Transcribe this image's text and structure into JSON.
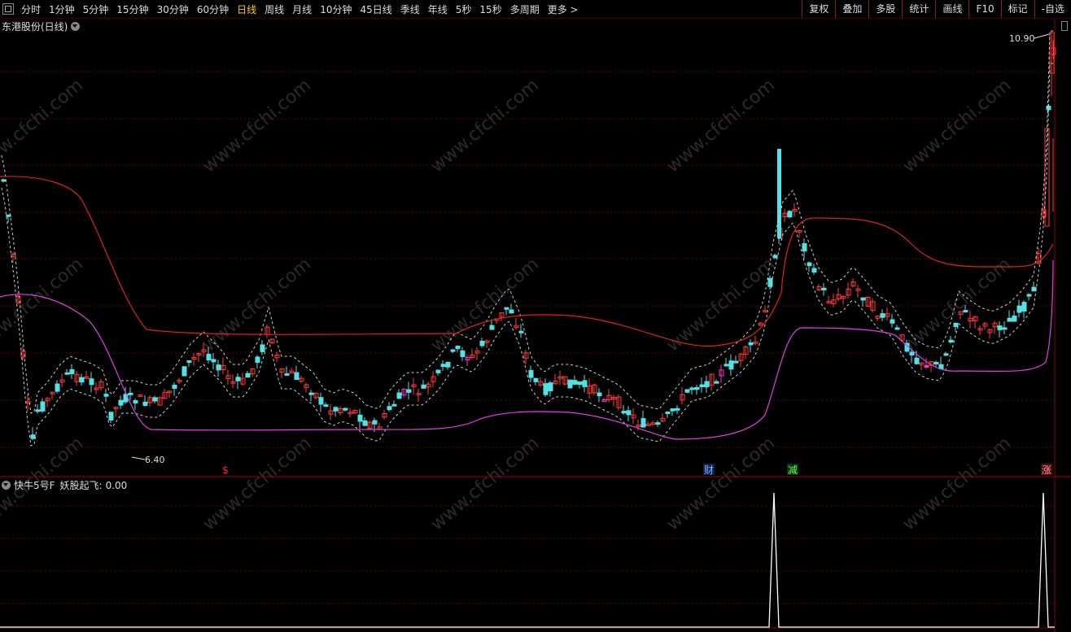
{
  "toolbar": {
    "periods": [
      "分时",
      "1分钟",
      "5分钟",
      "15分钟",
      "30分钟",
      "60分钟",
      "日线",
      "周线",
      "月线",
      "10分钟",
      "45日线",
      "季线",
      "年线",
      "5秒",
      "15秒",
      "多周期",
      "更多 >"
    ],
    "active_period": "日线",
    "right_buttons": [
      "复权",
      "叠加",
      "多股",
      "统计",
      "画线",
      "F10",
      "标记",
      "-自选"
    ]
  },
  "main_chart": {
    "title": "东港股份(日线)",
    "high_label": "10.90",
    "low_label": "6.40",
    "markers": [
      {
        "text": "$",
        "color": "#ff2b2b",
        "bg": "none"
      },
      {
        "text": "财",
        "color": "#7fb6ff",
        "bg": "#10204a"
      },
      {
        "text": "减",
        "color": "#5dff5d",
        "bg": "#0d300d"
      },
      {
        "text": "涨",
        "color": "#ff9a9a",
        "bg": "#4a0d0d"
      }
    ],
    "colors": {
      "up": "#ff3b3b",
      "down": "#4fe3e8",
      "highlight": "#ff33cc",
      "upper_band": "#e02020",
      "lower_band": "#e040e0",
      "dotted": "#cfcfcf",
      "grid": "#6a0000"
    }
  },
  "sub_chart": {
    "title": "快牛5号F",
    "indicator_label": "妖股起飞:",
    "indicator_value": "0.00",
    "line_color": "#ffffff"
  },
  "watermark": "www.cfchi.com"
}
